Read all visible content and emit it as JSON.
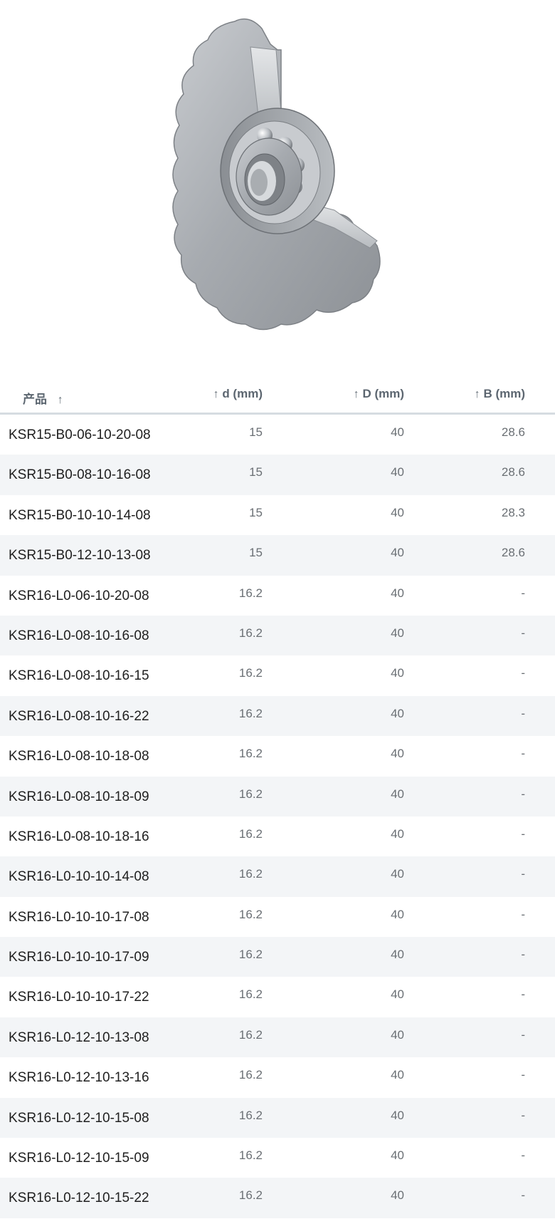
{
  "table": {
    "headers": {
      "product": "产品",
      "d": "d (mm)",
      "D": "D (mm)",
      "B": "B (mm)",
      "sort_arrow": "↑"
    },
    "rows": [
      {
        "product": "KSR15-B0-06-10-20-08",
        "d": "15",
        "D": "40",
        "B": "28.6"
      },
      {
        "product": "KSR15-B0-08-10-16-08",
        "d": "15",
        "D": "40",
        "B": "28.6"
      },
      {
        "product": "KSR15-B0-10-10-14-08",
        "d": "15",
        "D": "40",
        "B": "28.3"
      },
      {
        "product": "KSR15-B0-12-10-13-08",
        "d": "15",
        "D": "40",
        "B": "28.6"
      },
      {
        "product": "KSR16-L0-06-10-20-08",
        "d": "16.2",
        "D": "40",
        "B": "-"
      },
      {
        "product": "KSR16-L0-08-10-16-08",
        "d": "16.2",
        "D": "40",
        "B": "-"
      },
      {
        "product": "KSR16-L0-08-10-16-15",
        "d": "16.2",
        "D": "40",
        "B": "-"
      },
      {
        "product": "KSR16-L0-08-10-16-22",
        "d": "16.2",
        "D": "40",
        "B": "-"
      },
      {
        "product": "KSR16-L0-08-10-18-08",
        "d": "16.2",
        "D": "40",
        "B": "-"
      },
      {
        "product": "KSR16-L0-08-10-18-09",
        "d": "16.2",
        "D": "40",
        "B": "-"
      },
      {
        "product": "KSR16-L0-08-10-18-16",
        "d": "16.2",
        "D": "40",
        "B": "-"
      },
      {
        "product": "KSR16-L0-10-10-14-08",
        "d": "16.2",
        "D": "40",
        "B": "-"
      },
      {
        "product": "KSR16-L0-10-10-17-08",
        "d": "16.2",
        "D": "40",
        "B": "-"
      },
      {
        "product": "KSR16-L0-10-10-17-09",
        "d": "16.2",
        "D": "40",
        "B": "-"
      },
      {
        "product": "KSR16-L0-10-10-17-22",
        "d": "16.2",
        "D": "40",
        "B": "-"
      },
      {
        "product": "KSR16-L0-12-10-13-08",
        "d": "16.2",
        "D": "40",
        "B": "-"
      },
      {
        "product": "KSR16-L0-12-10-13-16",
        "d": "16.2",
        "D": "40",
        "B": "-"
      },
      {
        "product": "KSR16-L0-12-10-15-08",
        "d": "16.2",
        "D": "40",
        "B": "-"
      },
      {
        "product": "KSR16-L0-12-10-15-09",
        "d": "16.2",
        "D": "40",
        "B": "-"
      },
      {
        "product": "KSR16-L0-12-10-15-22",
        "d": "16.2",
        "D": "40",
        "B": "-"
      }
    ]
  },
  "colors": {
    "header_text": "#5c6670",
    "header_rule": "#d6dce1",
    "stripe": "#f3f5f7",
    "name_text": "#202020",
    "num_text": "#6a6f74"
  },
  "icons": {
    "sort": "arrow-up-icon",
    "product_image": "sprocket-bearing-image"
  }
}
